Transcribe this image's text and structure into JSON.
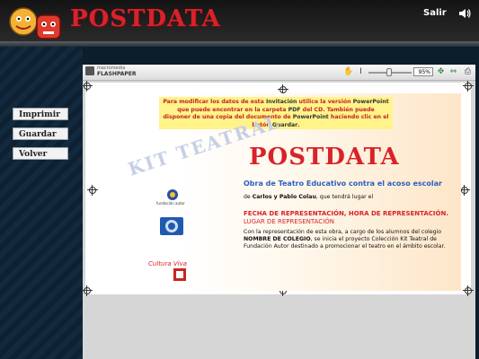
{
  "header": {
    "brand": "POSTDATA",
    "salir_label": "Salir",
    "speaker_icon": "speaker-icon"
  },
  "sidebar": {
    "buttons": [
      {
        "label": "Imprimir"
      },
      {
        "label": "Guardar"
      },
      {
        "label": "Volver"
      }
    ]
  },
  "viewer": {
    "brand_small": "macromedia",
    "brand_product": "FLASHPAPER",
    "zoom": "95%",
    "icons": [
      "hand-icon",
      "text-cursor-icon",
      "zoom-fit-icon",
      "fit-page-icon",
      "print-icon"
    ]
  },
  "document": {
    "notice_pre": "Para modificar los datos de esta ",
    "notice_b1": "Invitación",
    "notice_mid1": " utilice la versión ",
    "notice_b2": "PowerPoint",
    "notice_mid2": " que puede encontrar en la carpeta ",
    "notice_b3": "PDF",
    "notice_mid3": " del CD. También puede disponer de una copia del documento de ",
    "notice_b4": "PowerPoint",
    "notice_mid4": " haciendo clic en el botón ",
    "notice_b5": "Guardar",
    "notice_end": ".",
    "watermark": "KIT TEATRAL",
    "title": "POSTDATA",
    "subtitle": "Obra de Teatro Educativo contra el acoso escolar",
    "authors_pre": "de ",
    "authors": "Carlos y Pablo Colau",
    "authors_post": ", que tendrá lugar el",
    "fecha": "FECHA DE REPRESENTACIÓN, HORA DE REPRESENTACIÓN.",
    "lugar": "LUGAR DE REPRESENTACIÓN",
    "para1_pre": "Con la representación de esta obra, a cargo de los alumnos del colegio ",
    "para1_b": "NOMBRE DE COLEGIO",
    "para1_post": ", se inicia el proyecto Colección Kit Teatral de Fundación Autor destinado a promocionar el teatro en el ámbito escolar.",
    "logo1_text": "fundación autor",
    "logo3_text": "Cultura Viva"
  }
}
